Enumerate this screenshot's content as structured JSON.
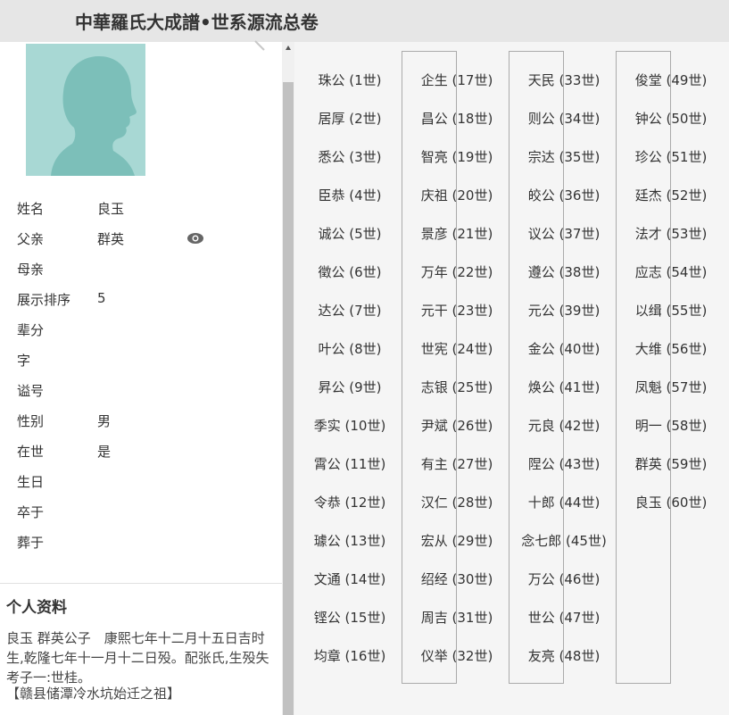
{
  "header": {
    "title": "中華羅氏大成譜•世系源流总卷"
  },
  "person": {
    "fields": [
      {
        "label": "姓名",
        "value": "良玉"
      },
      {
        "label": "父亲",
        "value": "群英"
      },
      {
        "label": "母亲",
        "value": ""
      },
      {
        "label": "展示排序",
        "value": "5"
      },
      {
        "label": "辈分",
        "value": ""
      },
      {
        "label": "字",
        "value": ""
      },
      {
        "label": "谥号",
        "value": ""
      },
      {
        "label": "性别",
        "value": "男"
      },
      {
        "label": "在世",
        "value": "是"
      },
      {
        "label": "生日",
        "value": ""
      },
      {
        "label": "卒于",
        "value": ""
      },
      {
        "label": "葬于",
        "value": ""
      }
    ]
  },
  "profile": {
    "heading": "个人资料",
    "text": "良玉 群英公子　康熙七年十二月十五日吉时生,乾隆七年十一月十二日殁。配张氏,生殁失考子一:世桂。",
    "tag": "【赣县储潭冷水坑始迁之祖】"
  },
  "generations": [
    {
      "name": "珠公",
      "gen": "(1世)"
    },
    {
      "name": "居厚",
      "gen": "(2世)"
    },
    {
      "name": "悉公",
      "gen": "(3世)"
    },
    {
      "name": "臣恭",
      "gen": "(4世)"
    },
    {
      "name": "诚公",
      "gen": "(5世)"
    },
    {
      "name": "徵公",
      "gen": "(6世)"
    },
    {
      "name": "达公",
      "gen": "(7世)"
    },
    {
      "name": "叶公",
      "gen": "(8世)"
    },
    {
      "name": "昇公",
      "gen": "(9世)"
    },
    {
      "name": "季实",
      "gen": "(10世)"
    },
    {
      "name": "霄公",
      "gen": "(11世)"
    },
    {
      "name": "令恭",
      "gen": "(12世)"
    },
    {
      "name": "璩公",
      "gen": "(13世)"
    },
    {
      "name": "文通",
      "gen": "(14世)"
    },
    {
      "name": "铿公",
      "gen": "(15世)"
    },
    {
      "name": "均章",
      "gen": "(16世)"
    },
    {
      "name": "企生",
      "gen": "(17世)"
    },
    {
      "name": "昌公",
      "gen": "(18世)"
    },
    {
      "name": "智亮",
      "gen": "(19世)"
    },
    {
      "name": "庆祖",
      "gen": "(20世)"
    },
    {
      "name": "景彦",
      "gen": "(21世)"
    },
    {
      "name": "万年",
      "gen": "(22世)"
    },
    {
      "name": "元干",
      "gen": "(23世)"
    },
    {
      "name": "世宪",
      "gen": "(24世)"
    },
    {
      "name": "志银",
      "gen": "(25世)"
    },
    {
      "name": "尹斌",
      "gen": "(26世)"
    },
    {
      "name": "有主",
      "gen": "(27世)"
    },
    {
      "name": "汉仁",
      "gen": "(28世)"
    },
    {
      "name": "宏从",
      "gen": "(29世)"
    },
    {
      "name": "绍经",
      "gen": "(30世)"
    },
    {
      "name": "周吉",
      "gen": "(31世)"
    },
    {
      "name": "仪举",
      "gen": "(32世)"
    },
    {
      "name": "天民",
      "gen": "(33世)"
    },
    {
      "name": "则公",
      "gen": "(34世)"
    },
    {
      "name": "宗达",
      "gen": "(35世)"
    },
    {
      "name": "皎公",
      "gen": "(36世)"
    },
    {
      "name": "议公",
      "gen": "(37世)"
    },
    {
      "name": "遵公",
      "gen": "(38世)"
    },
    {
      "name": "元公",
      "gen": "(39世)"
    },
    {
      "name": "金公",
      "gen": "(40世)"
    },
    {
      "name": "焕公",
      "gen": "(41世)"
    },
    {
      "name": "元良",
      "gen": "(42世)"
    },
    {
      "name": "陧公",
      "gen": "(43世)"
    },
    {
      "name": "十郎",
      "gen": "(44世)"
    },
    {
      "name": "念七郎",
      "gen": "(45世)"
    },
    {
      "name": "万公",
      "gen": "(46世)"
    },
    {
      "name": "世公",
      "gen": "(47世)"
    },
    {
      "name": "友亮",
      "gen": "(48世)"
    },
    {
      "name": "俊堂",
      "gen": "(49世)"
    },
    {
      "name": "钟公",
      "gen": "(50世)"
    },
    {
      "name": "珍公",
      "gen": "(51世)"
    },
    {
      "name": "廷杰",
      "gen": "(52世)"
    },
    {
      "name": "法才",
      "gen": "(53世)"
    },
    {
      "name": "应志",
      "gen": "(54世)"
    },
    {
      "name": "以缉",
      "gen": "(55世)"
    },
    {
      "name": "大维",
      "gen": "(56世)"
    },
    {
      "name": "凤魁",
      "gen": "(57世)"
    },
    {
      "name": "明一",
      "gen": "(58世)"
    },
    {
      "name": "群英",
      "gen": "(59世)"
    },
    {
      "name": "良玉",
      "gen": "(60世)"
    }
  ]
}
